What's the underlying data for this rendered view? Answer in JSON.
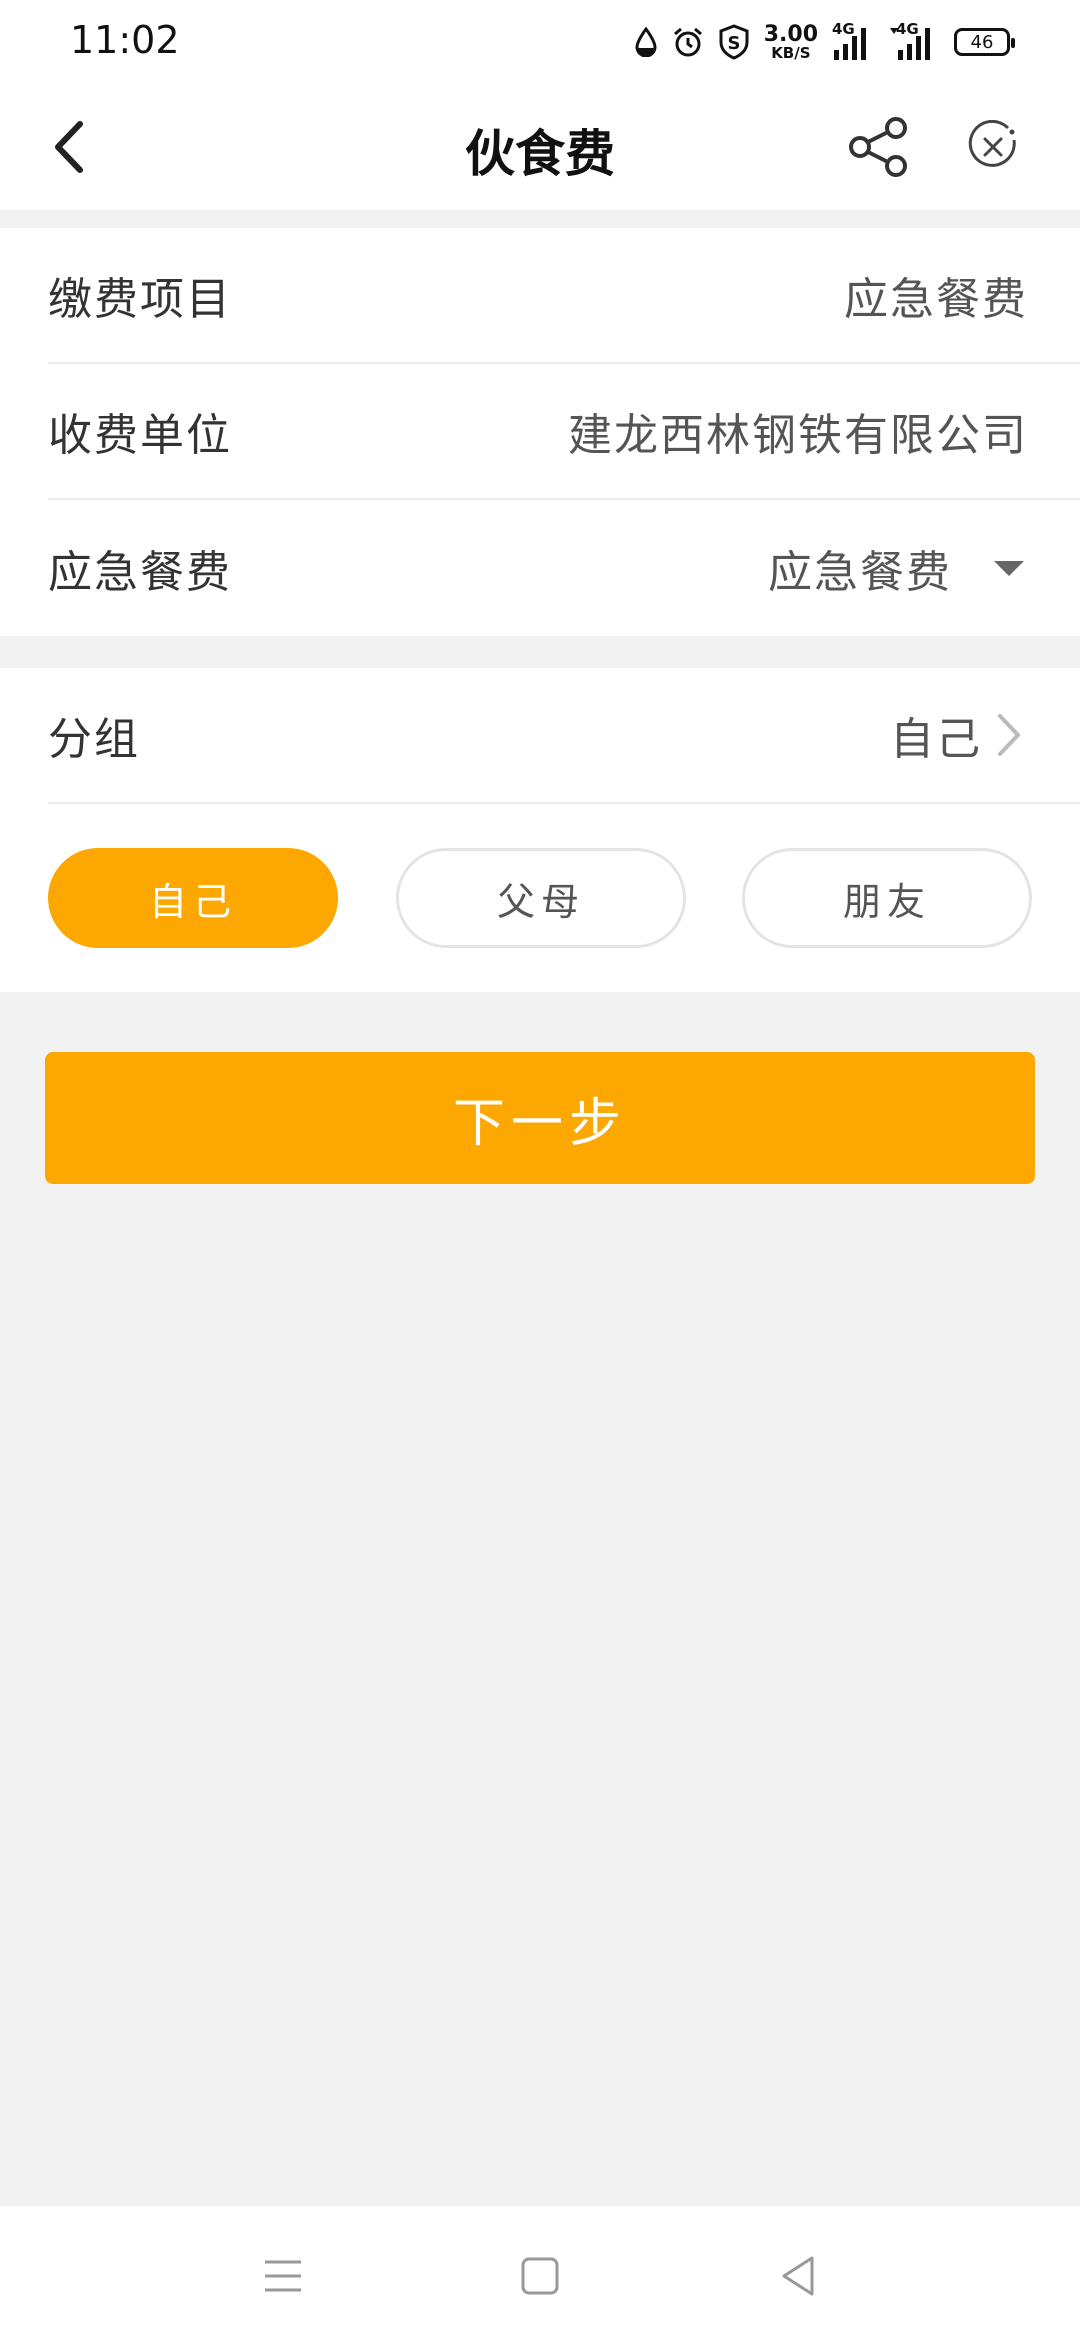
{
  "status_bar": {
    "time": "11:02",
    "net_speed_value": "3.00",
    "net_speed_unit": "KB/S",
    "network_1": "4G",
    "network_2": "4G",
    "battery_level": "46",
    "icons": [
      "water-drop-icon",
      "alarm-icon",
      "shield-s-icon",
      "signal-icon",
      "signal-icon",
      "battery-icon"
    ]
  },
  "header": {
    "title": "伙食费",
    "icons": [
      "back-icon",
      "share-icon",
      "close-icon"
    ]
  },
  "form": {
    "rows": [
      {
        "label": "缴费项目",
        "value": "应急餐费"
      },
      {
        "label": "收费单位",
        "value": "建龙西林钢铁有限公司"
      },
      {
        "label": "应急餐费",
        "value": "应急餐费"
      }
    ]
  },
  "group": {
    "label": "分组",
    "value": "自己",
    "options": [
      "自己",
      "父母",
      "朋友"
    ],
    "selected": "自己"
  },
  "next_button": {
    "label": "下一步"
  },
  "colors": {
    "accent": "#fca800",
    "background": "#f2f2f2"
  },
  "nav_bar": {
    "icons": [
      "menu-icon",
      "home-icon",
      "back-triangle-icon"
    ]
  }
}
